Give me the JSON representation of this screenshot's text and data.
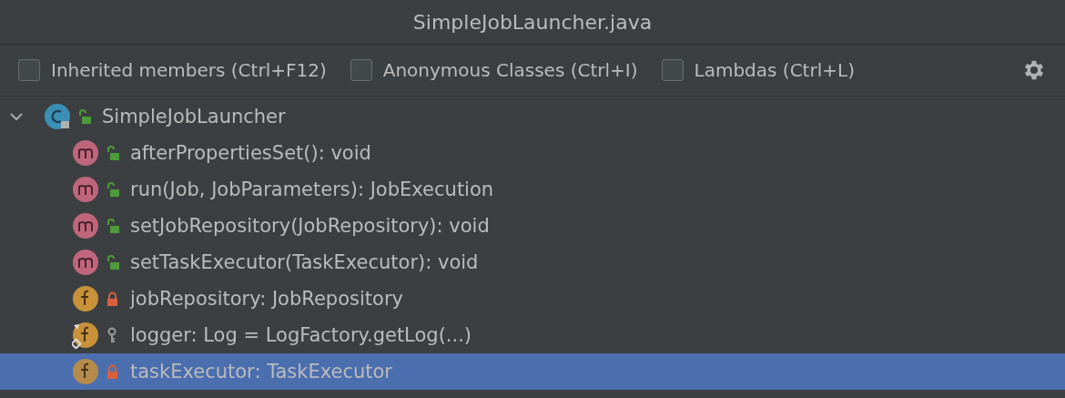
{
  "window": {
    "title": "SimpleJobLauncher.java"
  },
  "filters": [
    {
      "label": "Inherited members (Ctrl+F12)",
      "checked": false
    },
    {
      "label": "Anonymous Classes (Ctrl+I)",
      "checked": false
    },
    {
      "label": "Lambdas (Ctrl+L)",
      "checked": false
    }
  ],
  "tree": [
    {
      "name": "SimpleJobLauncher",
      "kind": "class",
      "access": {
        "kind": "public"
      },
      "static": false,
      "expanded": true,
      "selected": false,
      "children": [
        {
          "name": "afterPropertiesSet(): void",
          "kind": "method",
          "access": {
            "kind": "public"
          },
          "static": false,
          "selected": false
        },
        {
          "name": "run(Job, JobParameters): JobExecution",
          "kind": "method",
          "access": {
            "kind": "public"
          },
          "static": false,
          "selected": false
        },
        {
          "name": "setJobRepository(JobRepository): void",
          "kind": "method",
          "access": {
            "kind": "public"
          },
          "static": false,
          "selected": false
        },
        {
          "name": "setTaskExecutor(TaskExecutor): void",
          "kind": "method",
          "access": {
            "kind": "public"
          },
          "static": false,
          "selected": false
        },
        {
          "name": "jobRepository: JobRepository",
          "kind": "field",
          "access": {
            "kind": "private"
          },
          "static": false,
          "selected": false
        },
        {
          "name": "logger: Log = LogFactory.getLog(...)",
          "kind": "field",
          "access": {
            "kind": "package"
          },
          "static": true,
          "selected": false
        },
        {
          "name": "taskExecutor: TaskExecutor",
          "kind": "field",
          "access": {
            "kind": "private"
          },
          "static": false,
          "selected": true
        }
      ]
    }
  ]
}
